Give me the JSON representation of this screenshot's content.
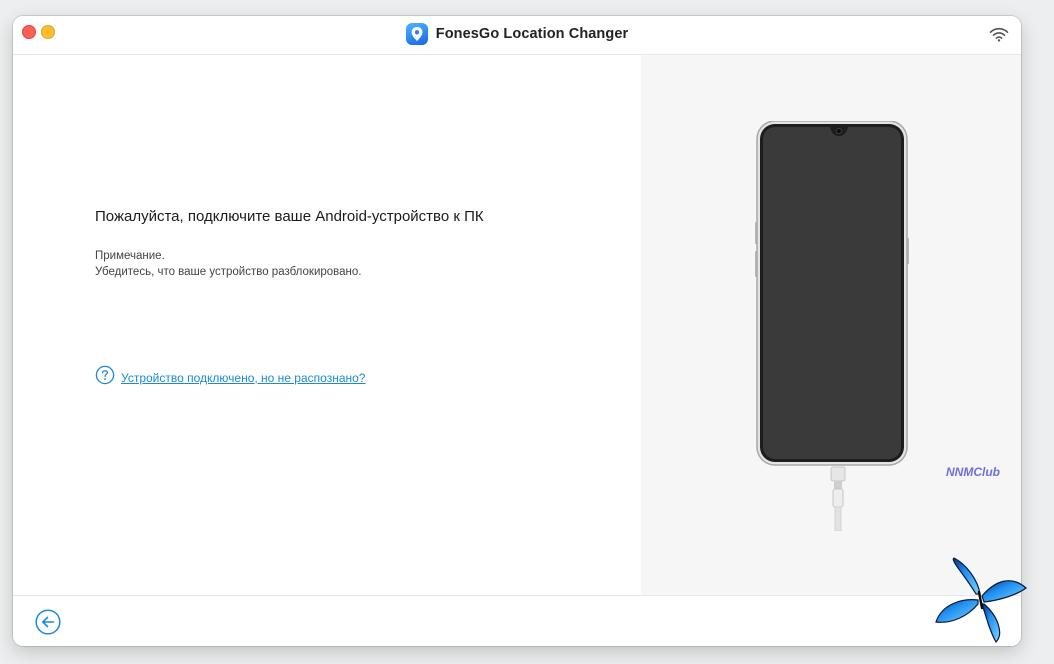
{
  "window": {
    "title": "FonesGo Location Changer"
  },
  "main": {
    "heading": "Пожалуйста, подключите ваше Android-устройство к ПК",
    "note_title": "Примечание.",
    "note_text": "Убедитесь, что ваше устройство разблокировано.",
    "help_link": "Устройство подключено, но не распознано?"
  },
  "watermark": "NNMClub",
  "icons": {
    "app": "location-pin-icon",
    "wifi": "wifi-icon",
    "help": "question-circle-icon",
    "back": "arrow-left-circle-icon",
    "butterfly": "butterfly-icon"
  },
  "colors": {
    "accent": "#1a8ad6",
    "close": "#fe5f57",
    "minimize": "#febc2e",
    "watermark": "#6f6fe0"
  }
}
